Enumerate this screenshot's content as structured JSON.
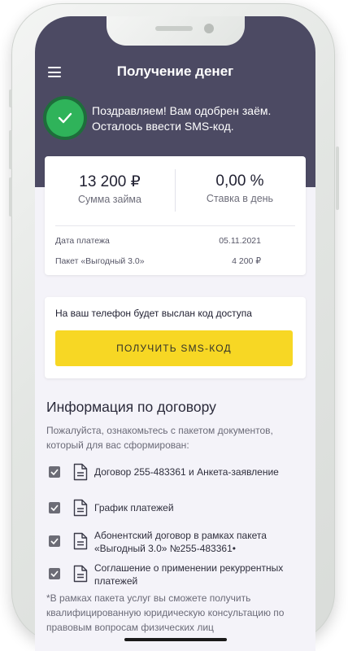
{
  "header": {
    "title": "Получение денег",
    "approval_line1": "Поздравляем! Вам одобрен заём.",
    "approval_line2": "Осталось ввести SMS-код."
  },
  "loan": {
    "amount_value": "13 200 ₽",
    "amount_label": "Сумма займа",
    "rate_value": "0,00 %",
    "rate_label": "Ставка в день",
    "details": [
      {
        "label": "Дата платежа",
        "value": "05.11.2021"
      },
      {
        "label": "Пакет «Выгодный 3.0»",
        "value": "4 200 ₽"
      }
    ]
  },
  "sms": {
    "notice": "На ваш телефон будет выслан код доступа",
    "button_label": "ПОЛУЧИТЬ SMS-КОД"
  },
  "contract": {
    "title": "Информация по договору",
    "description": "Пожалуйста, ознакомьтесь с пакетом документов, который для вас сформирован:",
    "documents": [
      {
        "line1": "Договор 255-483361 и Анкета-заявление",
        "line2": "",
        "checked": true
      },
      {
        "line1": "График платежей",
        "line2": "",
        "checked": true
      },
      {
        "line1": "Абонентский договор в рамках пакета",
        "line2": "«Выгодный 3.0» №255-483361•",
        "checked": true
      },
      {
        "line1": "Соглашение о применении рекуррентных",
        "line2": "платежей",
        "checked": true
      }
    ],
    "footnote": "*В рамках пакета услуг вы сможете получить квалифицированную юридическую консультацию по правовым вопросам физических лиц"
  },
  "colors": {
    "header_bg": "#4c4a63",
    "accent_yellow": "#f7d724",
    "success_green": "#2fb35a",
    "checkbox": "#6c6c76"
  },
  "icons": [
    "menu-icon",
    "check-icon",
    "checkbox-checked-icon",
    "document-icon"
  ]
}
